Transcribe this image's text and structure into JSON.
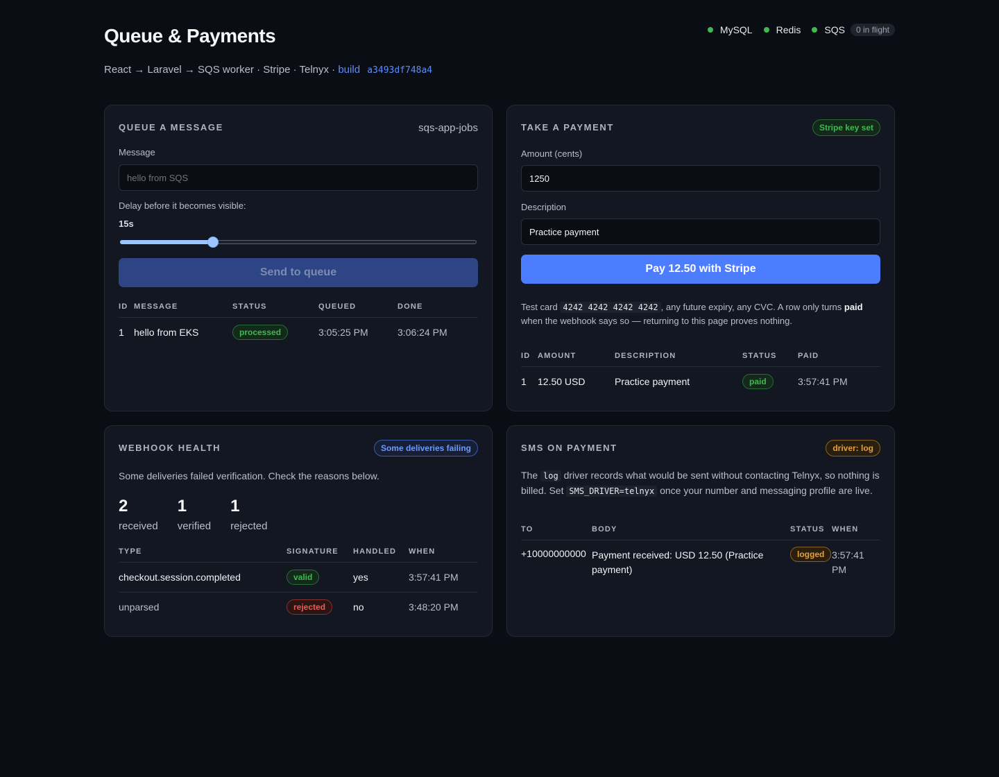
{
  "header": {
    "title": "Queue & Payments",
    "stack": "React → Laravel → SQS worker · Stripe · Telnyx ·",
    "build_label": "build",
    "build_hash": "a3493df748a4",
    "services": [
      {
        "name": "MySQL",
        "status_color": "#3fb950"
      },
      {
        "name": "Redis",
        "status_color": "#3fb950"
      },
      {
        "name": "SQS",
        "status_color": "#3fb950"
      }
    ],
    "inflight": "0 in flight"
  },
  "queue": {
    "title": "QUEUE A MESSAGE",
    "queue_name": "sqs-app-jobs",
    "message_label": "Message",
    "message_placeholder": "hello from SQS",
    "delay_label": "Delay before it becomes visible:",
    "delay_value": "15s",
    "delay_fraction": 0.26,
    "send_label": "Send to queue",
    "columns": [
      "ID",
      "MESSAGE",
      "STATUS",
      "QUEUED",
      "DONE"
    ],
    "rows": [
      {
        "id": "1",
        "message": "hello from EKS",
        "status": "processed",
        "queued": "3:05:25 PM",
        "done": "3:06:24 PM"
      }
    ]
  },
  "payment": {
    "title": "TAKE A PAYMENT",
    "badge": "Stripe key set",
    "amount_label": "Amount (cents)",
    "amount_value": "1250",
    "description_label": "Description",
    "description_value": "Practice payment",
    "pay_label": "Pay 12.50 with Stripe",
    "note_prefix": "Test card",
    "test_card": "4242 4242 4242 4242",
    "note_middle": ", any future expiry, any CVC. A row only turns",
    "note_bold": "paid",
    "note_suffix": "when the webhook says so — returning to this page proves nothing.",
    "columns": [
      "ID",
      "AMOUNT",
      "DESCRIPTION",
      "STATUS",
      "PAID"
    ],
    "rows": [
      {
        "id": "1",
        "amount": "12.50 USD",
        "description": "Practice payment",
        "status": "paid",
        "paid": "3:57:41 PM"
      }
    ]
  },
  "webhook": {
    "title": "WEBHOOK HEALTH",
    "badge": "Some deliveries failing",
    "summary": "Some deliveries failed verification. Check the reasons below.",
    "stats": [
      {
        "value": "2",
        "label": "received"
      },
      {
        "value": "1",
        "label": "verified"
      },
      {
        "value": "1",
        "label": "rejected"
      }
    ],
    "columns": [
      "TYPE",
      "SIGNATURE",
      "HANDLED",
      "WHEN"
    ],
    "rows": [
      {
        "type": "checkout.session.completed",
        "signature": "valid",
        "handled": "yes",
        "when": "3:57:41 PM"
      },
      {
        "type": "unparsed",
        "signature": "rejected",
        "handled": "no",
        "when": "3:48:20 PM"
      }
    ]
  },
  "sms": {
    "title": "SMS ON PAYMENT",
    "badge": "driver: log",
    "note_1": "The",
    "code_1": "log",
    "note_2": "driver records what would be sent without contacting Telnyx, so nothing is billed. Set",
    "code_2": "SMS_DRIVER=telnyx",
    "note_3": "once your number and messaging profile are live.",
    "columns": [
      "TO",
      "BODY",
      "STATUS",
      "WHEN"
    ],
    "rows": [
      {
        "to": "+10000000000",
        "body": "Payment received: USD 12.50 (Practice payment)",
        "status": "logged",
        "when": "3:57:41 PM"
      }
    ]
  }
}
